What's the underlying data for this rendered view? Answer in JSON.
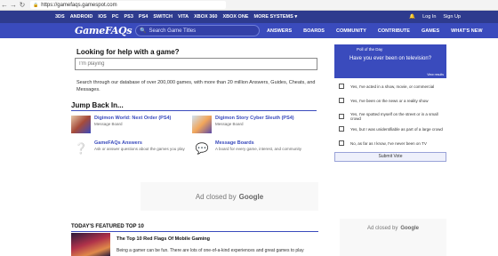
{
  "browser": {
    "back": "←",
    "forward": "→",
    "reload": "↻",
    "url": "https://gamefaqs.gamespot.com"
  },
  "platforms": {
    "items": [
      "3DS",
      "ANDROID",
      "IOS",
      "PC",
      "PS3",
      "PS4",
      "SWITCH",
      "VITA",
      "XBOX 360",
      "XBOX ONE"
    ],
    "more": "MORE SYSTEMS ▾",
    "login": "Log In",
    "signup": "Sign Up"
  },
  "header": {
    "logo": "GameFAQs",
    "search_placeholder": "Search Game Titles",
    "nav": [
      "ANSWERS",
      "BOARDS",
      "COMMUNITY",
      "CONTRIBUTE",
      "GAMES",
      "WHAT'S NEW"
    ]
  },
  "help": {
    "title": "Looking for help with a game?",
    "input_placeholder": "I'm playing",
    "description": "Search through our database of over 200,000 games, with more than 20 million Answers, Guides, Cheats, and Messages."
  },
  "jump": {
    "title": "Jump Back In...",
    "items": [
      {
        "title": "Digimon World: Next Order (PS4)",
        "sub": "Message Board"
      },
      {
        "title": "Digimon Story Cyber Sleuth (PS4)",
        "sub": "Message Board"
      },
      {
        "title": "GameFAQs Answers",
        "sub": "Ask or answer questions about the games you play"
      },
      {
        "title": "Message Boards",
        "sub": "A board for every game, interest, and community"
      }
    ]
  },
  "poll": {
    "tag": "Poll of the Day",
    "question": "Have you ever been on television?",
    "results": "View results",
    "options": [
      "Yes, I've acted in a show, movie, or commercial",
      "Yes, I've been on the news or a reality show",
      "Yes, I've spotted myself on the street or in a small crowd",
      "Yes, but I was unidentifiable as part of a large crowd",
      "No, as far as I know, I've never been on TV"
    ],
    "submit": "Submit Vote"
  },
  "ads": {
    "closed_text": "Ad closed by",
    "brand": "Google"
  },
  "featured": {
    "title": "TODAY'S FEATURED TOP 10",
    "article_title": "The Top 10 Red Flags Of Mobile Gaming",
    "article_body": "Being a gamer can be fun. There are lots of one-of-a-kind experiences and great games to play"
  },
  "colors": {
    "brand_dark": "#2e3b8e",
    "brand": "#3a4bbd"
  }
}
